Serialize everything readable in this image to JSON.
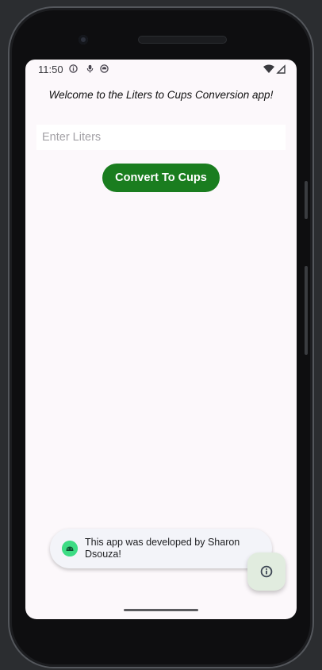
{
  "status_bar": {
    "time": "11:50",
    "left_icons": [
      "info-icon",
      "mic-icon",
      "android-icon"
    ],
    "right_icons": [
      "wifi-icon",
      "cellular-signal-icon"
    ]
  },
  "main": {
    "welcome_text": "Welcome to the Liters to Cups Conversion app!",
    "liters_input": {
      "value": "",
      "placeholder": "Enter Liters"
    },
    "convert_button_label": "Convert To Cups"
  },
  "toast": {
    "icon": "android-icon",
    "message": "This app was developed by Sharon Dsouza!"
  },
  "fab": {
    "icon": "info-icon"
  },
  "colors": {
    "accent_green": "#1a7d1f",
    "screen_background": "#fcf8fb",
    "fab_background": "#e1ecdf",
    "toast_icon": "#3ddc84"
  }
}
